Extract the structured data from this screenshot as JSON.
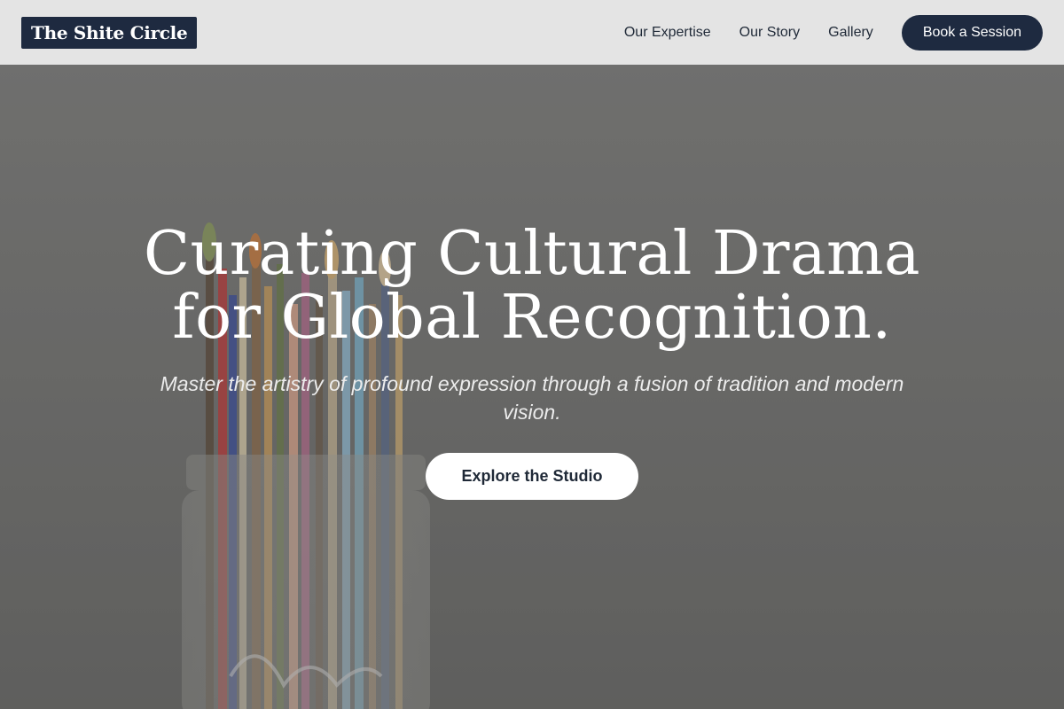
{
  "header": {
    "logo_text": "The Shite Circle",
    "nav": [
      {
        "label": "Our Expertise"
      },
      {
        "label": "Our Story"
      },
      {
        "label": "Gallery"
      }
    ],
    "cta_label": "Book a Session"
  },
  "hero": {
    "title_line1": "Curating Cultural Drama",
    "title_line2": "for Global Recognition.",
    "subtitle": "Master the artistry of profound expression through a fusion of tradition and modern vision.",
    "cta_label": "Explore the Studio"
  },
  "colors": {
    "header_bg": "#e4e4e4",
    "brand_navy": "#1e2a40",
    "hero_text": "#ffffff",
    "cta_bg": "#ffffff"
  }
}
